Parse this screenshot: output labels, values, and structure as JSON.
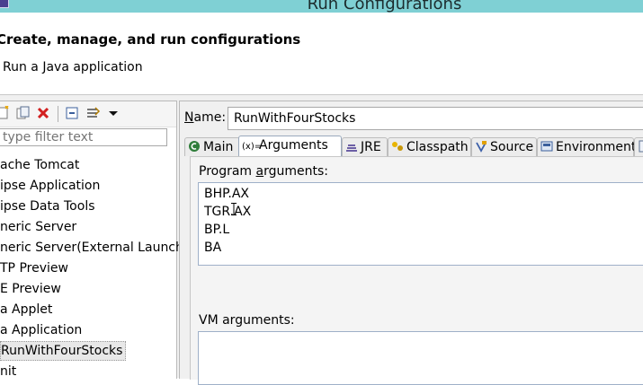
{
  "window": {
    "title": "Run Configurations"
  },
  "header": {
    "title": "Create, manage, and run configurations",
    "subtitle": "Run a Java application"
  },
  "left": {
    "filter_placeholder": "type filter text",
    "items": [
      {
        "label": "ache Tomcat"
      },
      {
        "label": "ipse Application"
      },
      {
        "label": "ipse Data Tools"
      },
      {
        "label": "neric Server"
      },
      {
        "label": "neric Server(External Launch)"
      },
      {
        "label": "TP Preview"
      },
      {
        "label": "E Preview"
      },
      {
        "label": "a Applet"
      },
      {
        "label": "a Application"
      },
      {
        "label": "RunWithFourStocks"
      },
      {
        "label": "nit"
      }
    ]
  },
  "right": {
    "name_label_n": "N",
    "name_label_rest": "ame:",
    "name_value": "RunWithFourStocks",
    "tabs": [
      {
        "label": "Main"
      },
      {
        "label": "Arguments"
      },
      {
        "label": "JRE"
      },
      {
        "label": "Classpath"
      },
      {
        "label": "Source"
      },
      {
        "label": "Environment"
      }
    ],
    "program_label_pre": "Program ",
    "program_label_mn": "a",
    "program_label_post": "rguments:",
    "program_lines": [
      "BHP.AX",
      "TGR.AX",
      "BP.L",
      "BA"
    ],
    "vm_label": "VM arguments:"
  },
  "colors": {
    "titlebar": "#7fd0d4",
    "selection_border": "#9a9a9a"
  }
}
